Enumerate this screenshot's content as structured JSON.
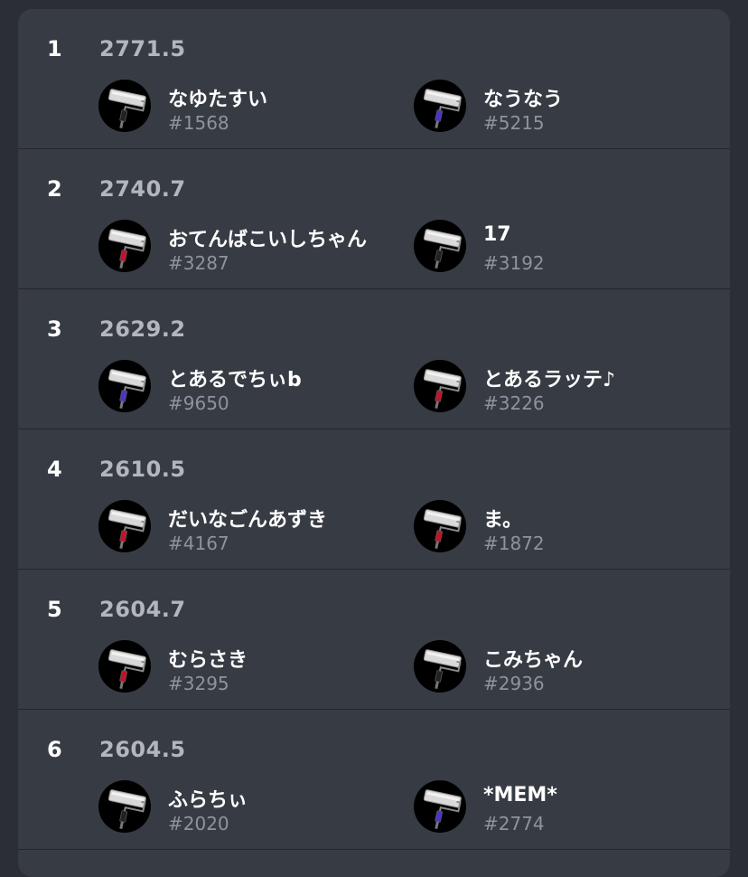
{
  "entries": [
    {
      "rank": "1",
      "score": "2771.5",
      "players": [
        {
          "name": "なゆたすい",
          "tag": "#1568",
          "weapon_icon": "roller-icon",
          "accent": "#222222"
        },
        {
          "name": "なうなう",
          "tag": "#5215",
          "weapon_icon": "roller-icon",
          "accent": "#4b35c8"
        }
      ]
    },
    {
      "rank": "2",
      "score": "2740.7",
      "players": [
        {
          "name": "おてんばこいしちゃん",
          "tag": "#3287",
          "weapon_icon": "roller-icon",
          "accent": "#c0142a"
        },
        {
          "name": "17",
          "tag": "#3192",
          "weapon_icon": "roller-icon",
          "accent": "#222222"
        }
      ]
    },
    {
      "rank": "3",
      "score": "2629.2",
      "players": [
        {
          "name": "とあるでちぃb",
          "tag": "#9650",
          "weapon_icon": "roller-icon",
          "accent": "#4b35c8"
        },
        {
          "name": "とあるラッテ♪",
          "tag": "#3226",
          "weapon_icon": "roller-icon",
          "accent": "#c0142a"
        }
      ]
    },
    {
      "rank": "4",
      "score": "2610.5",
      "players": [
        {
          "name": "だいなごんあずき",
          "tag": "#4167",
          "weapon_icon": "roller-icon",
          "accent": "#c0142a"
        },
        {
          "name": "ま。",
          "tag": "#1872",
          "weapon_icon": "roller-icon",
          "accent": "#c0142a"
        }
      ]
    },
    {
      "rank": "5",
      "score": "2604.7",
      "players": [
        {
          "name": "むらさき",
          "tag": "#3295",
          "weapon_icon": "roller-icon",
          "accent": "#c0142a"
        },
        {
          "name": "こみちゃん",
          "tag": "#2936",
          "weapon_icon": "roller-icon",
          "accent": "#222222"
        }
      ]
    },
    {
      "rank": "6",
      "score": "2604.5",
      "players": [
        {
          "name": "ふらちぃ",
          "tag": "#2020",
          "weapon_icon": "roller-icon",
          "accent": "#222222"
        },
        {
          "name": "*MEM*",
          "tag": "#2774",
          "weapon_icon": "roller-icon",
          "accent": "#4b35c8"
        }
      ]
    }
  ]
}
